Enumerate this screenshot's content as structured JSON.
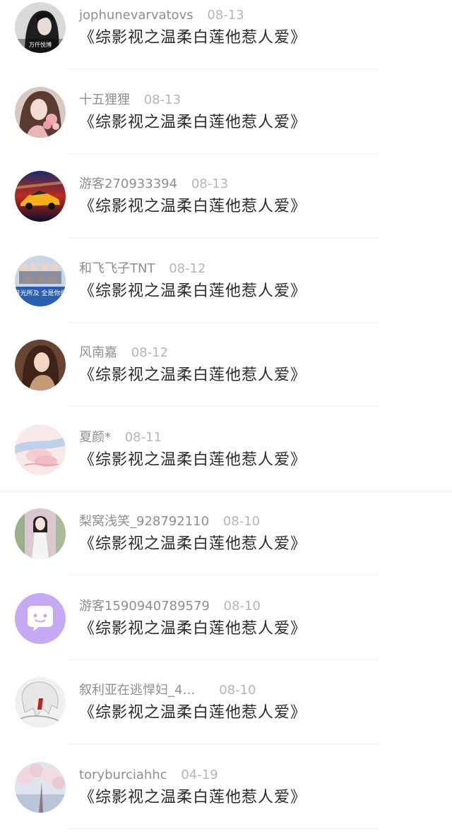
{
  "comments": [
    {
      "username": "jophunevarvatovs",
      "date": "08-13",
      "text": "《综影视之温柔白莲他惹人爱》",
      "avatar_caption": "万仟悦博",
      "avatar_icon": "avatar-girl-dark-icon"
    },
    {
      "username": "十五狸狸",
      "date": "08-13",
      "text": "《综影视之温柔白莲他惹人爱》",
      "avatar_icon": "avatar-girl-flowers-icon"
    },
    {
      "username": "游客270933394",
      "date": "08-13",
      "text": "《综影视之温柔白莲他惹人爱》",
      "avatar_icon": "avatar-car-icon"
    },
    {
      "username": "和飞飞子TNT",
      "date": "08-12",
      "text": "《综影视之温柔白莲他惹人爱》",
      "avatar_caption": "目光所及 全是你们",
      "avatar_icon": "avatar-group-icon"
    },
    {
      "username": "风南嘉",
      "date": "08-12",
      "text": "《综影视之温柔白莲他惹人爱》",
      "avatar_icon": "avatar-girl-warm-icon"
    },
    {
      "username": "夏颜*",
      "date": "08-11",
      "text": "《综影视之温柔白莲他惹人爱》",
      "avatar_icon": "avatar-hands-icon"
    },
    {
      "username": "梨窝浅笑_928792110",
      "date": "08-10",
      "text": "《综影视之温柔白莲他惹人爱》",
      "avatar_icon": "avatar-girl-white-icon"
    },
    {
      "username": "游客1590940789579",
      "date": "08-10",
      "text": "《综影视之温柔白莲他惹人爱》",
      "avatar_icon": "chat-bubble-icon"
    },
    {
      "username": "叙利亚在逃悍妇_4…",
      "date": "08-10",
      "text": "《综影视之温柔白莲他惹人爱》",
      "avatar_icon": "avatar-anime-icon"
    },
    {
      "username": "toryburciahhc",
      "date": "04-19",
      "text": "《综影视之温柔白莲他惹人爱》",
      "avatar_icon": "avatar-blossom-icon"
    }
  ]
}
